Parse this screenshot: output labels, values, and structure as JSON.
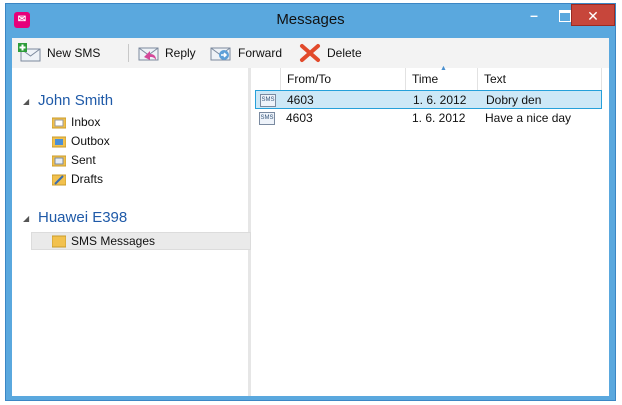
{
  "window": {
    "title": "Messages"
  },
  "toolbar": {
    "new_sms": "New SMS",
    "reply": "Reply",
    "forward": "Forward",
    "delete": "Delete"
  },
  "accounts": [
    {
      "name": "John Smith",
      "folders": [
        "Inbox",
        "Outbox",
        "Sent",
        "Drafts"
      ]
    },
    {
      "name": "Huawei E398",
      "folders": [
        "SMS Messages"
      ]
    }
  ],
  "table": {
    "columns": [
      "From/To",
      "Time",
      "Text"
    ],
    "rows": [
      {
        "from": "4603",
        "time": "1. 6. 2012",
        "text": "Dobry den",
        "selected": true
      },
      {
        "from": "4603",
        "time": "1. 6. 2012",
        "text": "Have a nice day",
        "selected": false
      }
    ]
  },
  "colors": {
    "accent": "#5aa8de",
    "close": "#c7463b",
    "selection": "#cde8f7",
    "group_title": "#1f5aa8"
  }
}
